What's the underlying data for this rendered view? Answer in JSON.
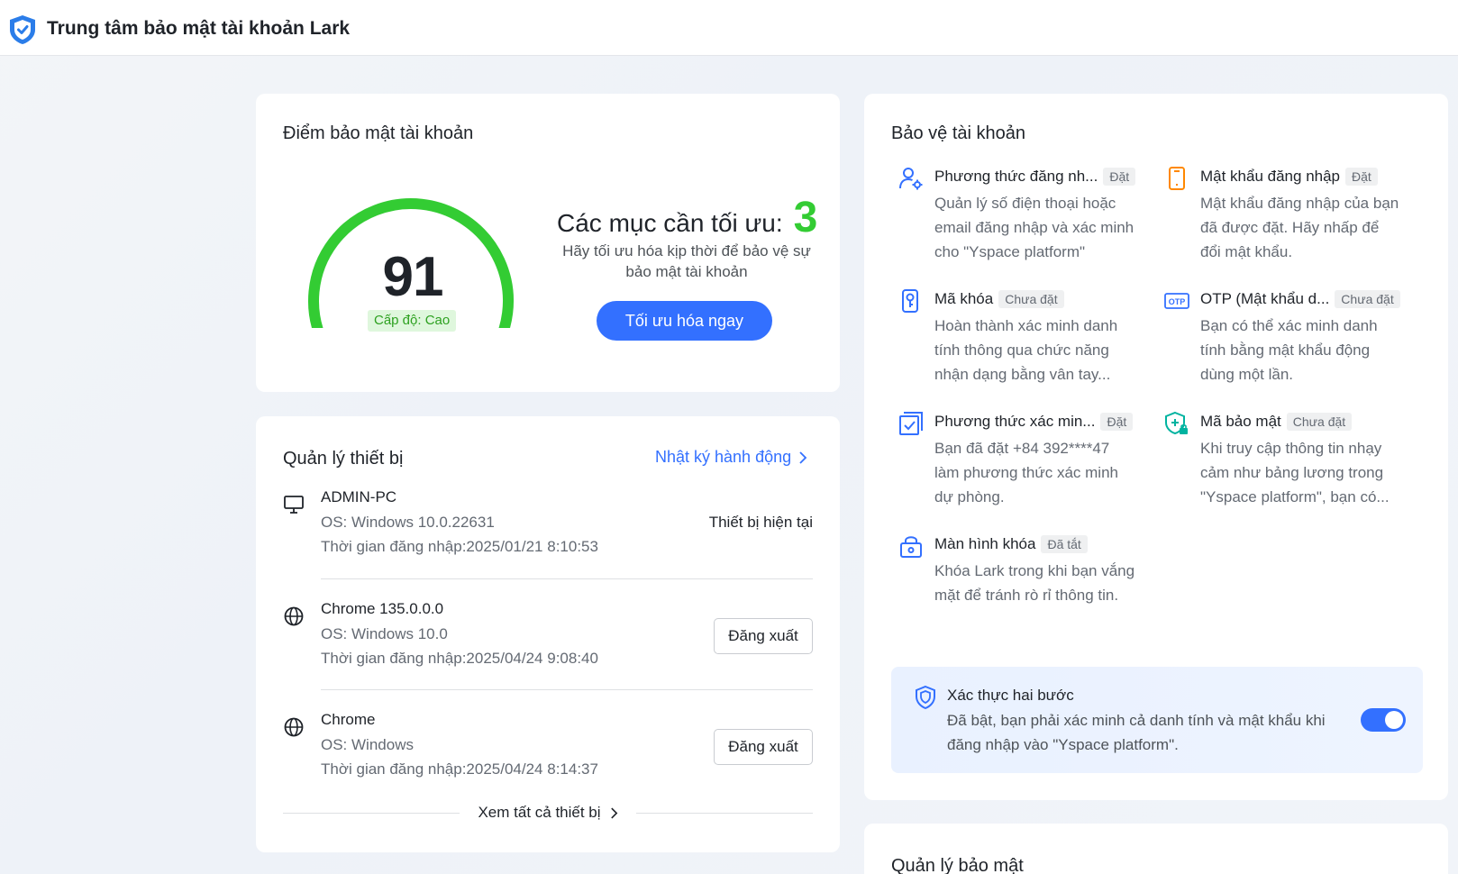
{
  "header": {
    "title": "Trung tâm bảo mật tài khoản Lark"
  },
  "score": {
    "title": "Điểm bảo mật tài khoản",
    "value": "91",
    "level": "Cấp độ: Cao",
    "gauge_fraction": 0.91,
    "optimize_label": "Các mục cần tối ưu:",
    "optimize_count": "3",
    "optimize_desc": "Hãy tối ưu hóa kịp thời để bảo vệ sự bảo mật tài khoản",
    "optimize_button": "Tối ưu hóa ngay"
  },
  "devices": {
    "title": "Quản lý thiết bị",
    "log_link": "Nhật ký hành động",
    "items": [
      {
        "name": "ADMIN-PC",
        "os": "OS: Windows 10.0.22631",
        "time": "Thời gian đăng nhập:2025/01/21 8:10:53",
        "status": "Thiết bị hiện tại",
        "icon": "monitor-icon"
      },
      {
        "name": "Chrome 135.0.0.0",
        "os": "OS: Windows 10.0",
        "time": "Thời gian đăng nhập:2025/04/24 9:08:40",
        "action": "Đăng xuất",
        "icon": "globe-icon"
      },
      {
        "name": "Chrome",
        "os": "OS: Windows",
        "time": "Thời gian đăng nhập:2025/04/24 8:14:37",
        "action": "Đăng xuất",
        "icon": "globe-icon"
      }
    ],
    "see_all": "Xem tất cả thiết bị"
  },
  "protection": {
    "title": "Bảo vệ tài khoản",
    "items": [
      {
        "name": "Phương thức đăng nh...",
        "badge": "Đặt",
        "desc": "Quản lý số điện thoại hoặc email đăng nhập và xác minh cho \"Yspace platform\"",
        "icon": "user-gear-icon"
      },
      {
        "name": "Mật khẩu đăng nhập",
        "badge": "Đặt",
        "desc": "Mật khẩu đăng nhập của bạn đã được đặt. Hãy nhấp để đổi mật khẩu.",
        "icon": "phone-icon"
      },
      {
        "name": "Mã khóa",
        "badge": "Chưa đặt",
        "desc": "Hoàn thành xác minh danh tính thông qua chức năng nhận dạng bằng vân tay...",
        "icon": "passkey-icon"
      },
      {
        "name": "OTP (Mật khẩu d...",
        "badge": "Chưa đặt",
        "desc": "Bạn có thể xác minh danh tính bằng mật khẩu động dùng một lần.",
        "icon": "otp-icon",
        "icon_text": "OTP"
      },
      {
        "name": "Phương thức xác min...",
        "badge": "Đặt",
        "desc": "Bạn đã đặt +84 392****47 làm phương thức xác minh dự phòng.",
        "icon": "verify-check-icon"
      },
      {
        "name": "Mã bảo mật",
        "badge": "Chưa đặt",
        "desc": "Khi truy cập thông tin nhạy cảm như bảng lương trong \"Yspace platform\", bạn có...",
        "icon": "security-code-icon"
      },
      {
        "name": "Màn hình khóa",
        "badge": "Đã tắt",
        "desc": "Khóa Lark trong khi bạn vắng mặt để tránh rò rỉ thông tin.",
        "icon": "lock-screen-icon"
      }
    ],
    "two_factor": {
      "title": "Xác thực hai bước",
      "desc": "Đã bật, bạn phải xác minh cả danh tính và mật khẩu khi đăng nhập vào \"Yspace platform\".",
      "enabled": true
    }
  },
  "security_mgmt": {
    "title": "Quản lý bảo mật"
  },
  "colors": {
    "accent": "#3370ff",
    "gauge": "#33cc33",
    "level_bg": "#dff7dd",
    "level_text": "#2ea121"
  }
}
